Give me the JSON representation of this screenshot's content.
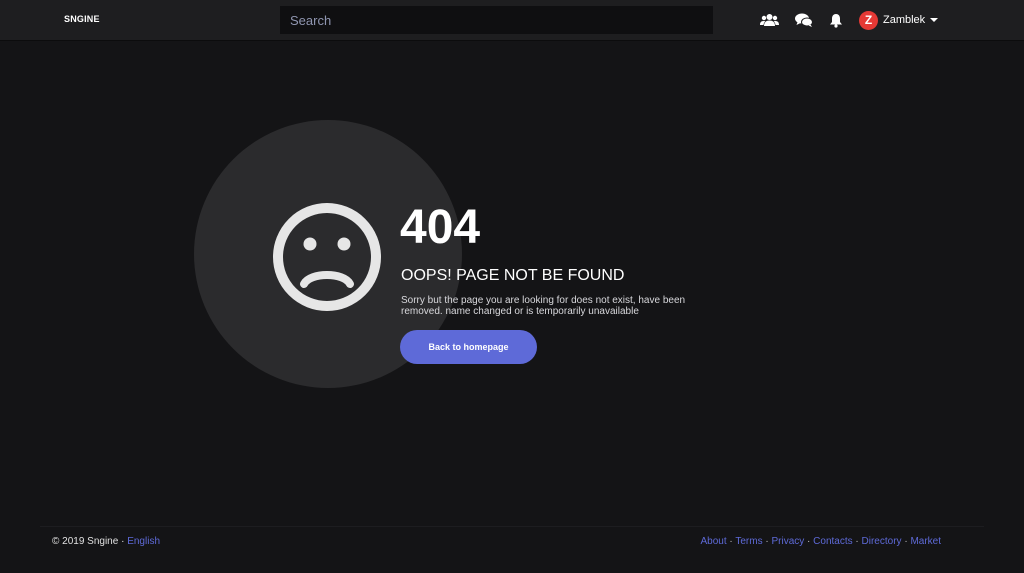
{
  "header": {
    "logo": "SNGINE",
    "search_placeholder": "Search",
    "icons": [
      "users-icon",
      "chat-icon",
      "bell-icon"
    ],
    "user": {
      "avatar_letter": "Z",
      "name": "Zamblek"
    }
  },
  "error": {
    "code": "404",
    "title": "OOPS! PAGE NOT BE FOUND",
    "description": "Sorry but the page you are looking for does not exist, have been removed. name changed or is temporarily unavailable",
    "button_label": "Back to homepage"
  },
  "footer": {
    "copyright": "© 2019 Sngine · ",
    "language": "English",
    "links": [
      "About",
      "Terms",
      "Privacy",
      "Contacts",
      "Directory",
      "Market"
    ],
    "separator": " · "
  },
  "colors": {
    "accent": "#5e6ad8",
    "background": "#141416",
    "header": "#1e1e20",
    "avatar": "#e53935"
  }
}
